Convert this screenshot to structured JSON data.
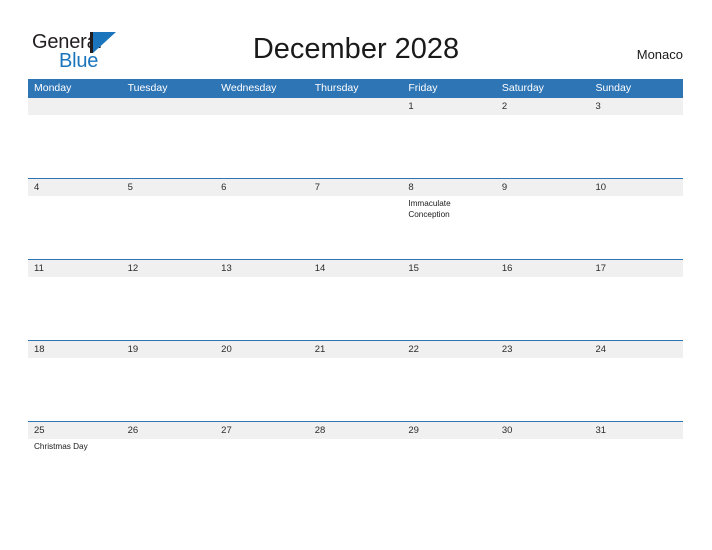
{
  "brand": {
    "name_part1": "General",
    "name_part2": "Blue",
    "logo_icon": "triangle-flag-icon",
    "accent_color": "#1a75bc"
  },
  "header": {
    "title": "December 2028",
    "location": "Monaco"
  },
  "theme": {
    "header_blue": "#2e75b6",
    "date_band_gray": "#f0f0f0",
    "cell_white": "#ffffff",
    "text_dark": "#1a1a1a"
  },
  "calendar": {
    "month": "December",
    "year": "2028",
    "week_start": "Monday",
    "day_headers": [
      "Monday",
      "Tuesday",
      "Wednesday",
      "Thursday",
      "Friday",
      "Saturday",
      "Sunday"
    ],
    "weeks": [
      {
        "dates": [
          "",
          "",
          "",
          "",
          "1",
          "2",
          "3"
        ],
        "events": [
          "",
          "",
          "",
          "",
          "",
          "",
          ""
        ]
      },
      {
        "dates": [
          "4",
          "5",
          "6",
          "7",
          "8",
          "9",
          "10"
        ],
        "events": [
          "",
          "",
          "",
          "",
          "Immaculate Conception",
          "",
          ""
        ]
      },
      {
        "dates": [
          "11",
          "12",
          "13",
          "14",
          "15",
          "16",
          "17"
        ],
        "events": [
          "",
          "",
          "",
          "",
          "",
          "",
          ""
        ]
      },
      {
        "dates": [
          "18",
          "19",
          "20",
          "21",
          "22",
          "23",
          "24"
        ],
        "events": [
          "",
          "",
          "",
          "",
          "",
          "",
          ""
        ]
      },
      {
        "dates": [
          "25",
          "26",
          "27",
          "28",
          "29",
          "30",
          "31"
        ],
        "events": [
          "Christmas Day",
          "",
          "",
          "",
          "",
          "",
          ""
        ]
      }
    ]
  }
}
